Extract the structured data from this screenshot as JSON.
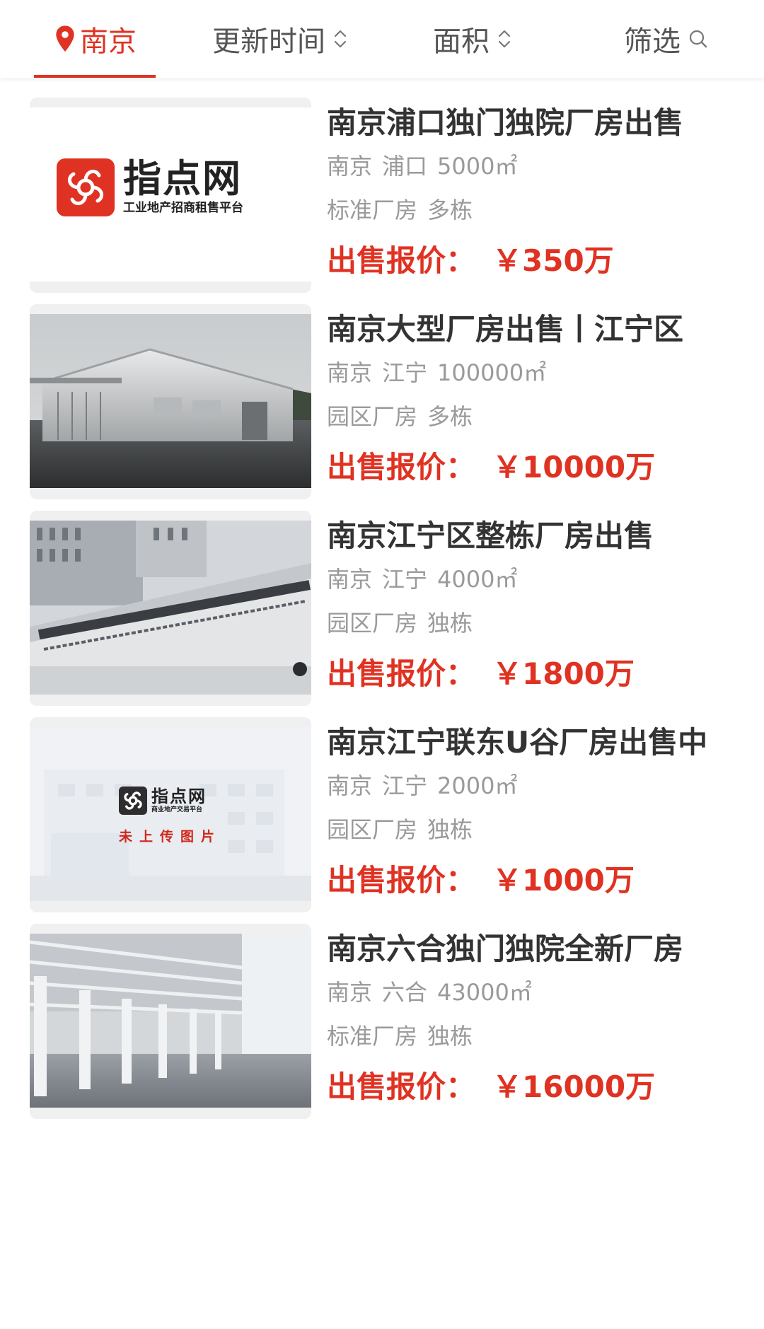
{
  "filters": {
    "city": "南京",
    "time": "更新时间",
    "area": "面积",
    "screen": "筛选"
  },
  "colors": {
    "accent": "#e03222",
    "title": "#333333",
    "meta": "#9a9a9a"
  },
  "icons": {
    "city": "location-pin-icon",
    "sort": "sort-updown-icon",
    "search": "search-icon"
  },
  "listings": [
    {
      "title": "南京浦口独门独院厂房出售",
      "city": "南京",
      "district": "浦口",
      "area": "5000㎡",
      "type": "标准厂房",
      "buildings": "多栋",
      "price_label": "出售报价：",
      "price": "￥350万",
      "image": "logo"
    },
    {
      "title": "南京大型厂房出售丨江宁区",
      "city": "南京",
      "district": "江宁",
      "area": "100000㎡",
      "type": "园区厂房",
      "buildings": "多栋",
      "price_label": "出售报价：",
      "price": "￥10000万",
      "image": "warehouse-photo"
    },
    {
      "title": "南京江宁区整栋厂房出售",
      "city": "南京",
      "district": "江宁",
      "area": "4000㎡",
      "type": "园区厂房",
      "buildings": "独栋",
      "price_label": "出售报价：",
      "price": "￥1800万",
      "image": "park-sign-photo"
    },
    {
      "title": "南京江宁联东U谷厂房出售中",
      "city": "南京",
      "district": "江宁",
      "area": "2000㎡",
      "type": "园区厂房",
      "buildings": "独栋",
      "price_label": "出售报价：",
      "price": "￥1000万",
      "image": "placeholder",
      "placeholder_brand": "指点网",
      "placeholder_sub": "商业地产交易平台",
      "placeholder_note": "未上传图片"
    },
    {
      "title": "南京六合独门独院全新厂房",
      "city": "南京",
      "district": "六合",
      "area": "43000㎡",
      "type": "标准厂房",
      "buildings": "独栋",
      "price_label": "出售报价：",
      "price": "￥16000万",
      "image": "interior-photo"
    }
  ],
  "logo": {
    "brand": "指点网",
    "tagline": "工业地产招商租售平台"
  }
}
